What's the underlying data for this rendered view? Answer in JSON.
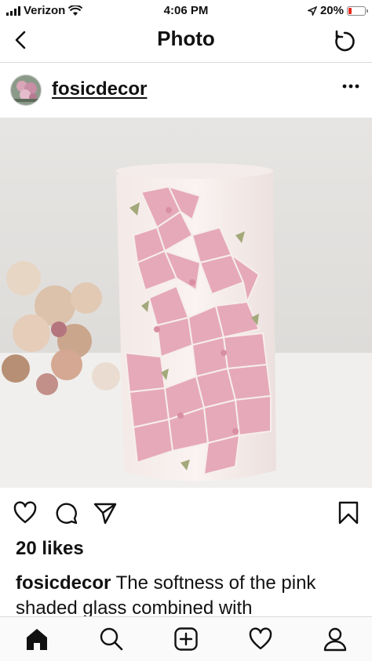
{
  "status_bar": {
    "carrier": "Verizon",
    "time": "4:06 PM",
    "battery": "20%",
    "battery_color": "#e8291c"
  },
  "nav": {
    "title": "Photo",
    "back_icon": "chevron-left-icon",
    "refresh_icon": "refresh-icon"
  },
  "post": {
    "username": "fosicdecor",
    "likes": "20 likes",
    "caption_user": "fosicdecor",
    "caption_text": " The softness of the pink shaded glass combined with"
  },
  "actions": [
    "heart-icon",
    "comment-icon",
    "share-icon",
    "bookmark-icon"
  ],
  "tabs": [
    "home-icon",
    "search-icon",
    "add-post-icon",
    "activity-icon",
    "profile-icon"
  ],
  "colors": {
    "text": "#111111",
    "divider": "#dbdbdb"
  }
}
